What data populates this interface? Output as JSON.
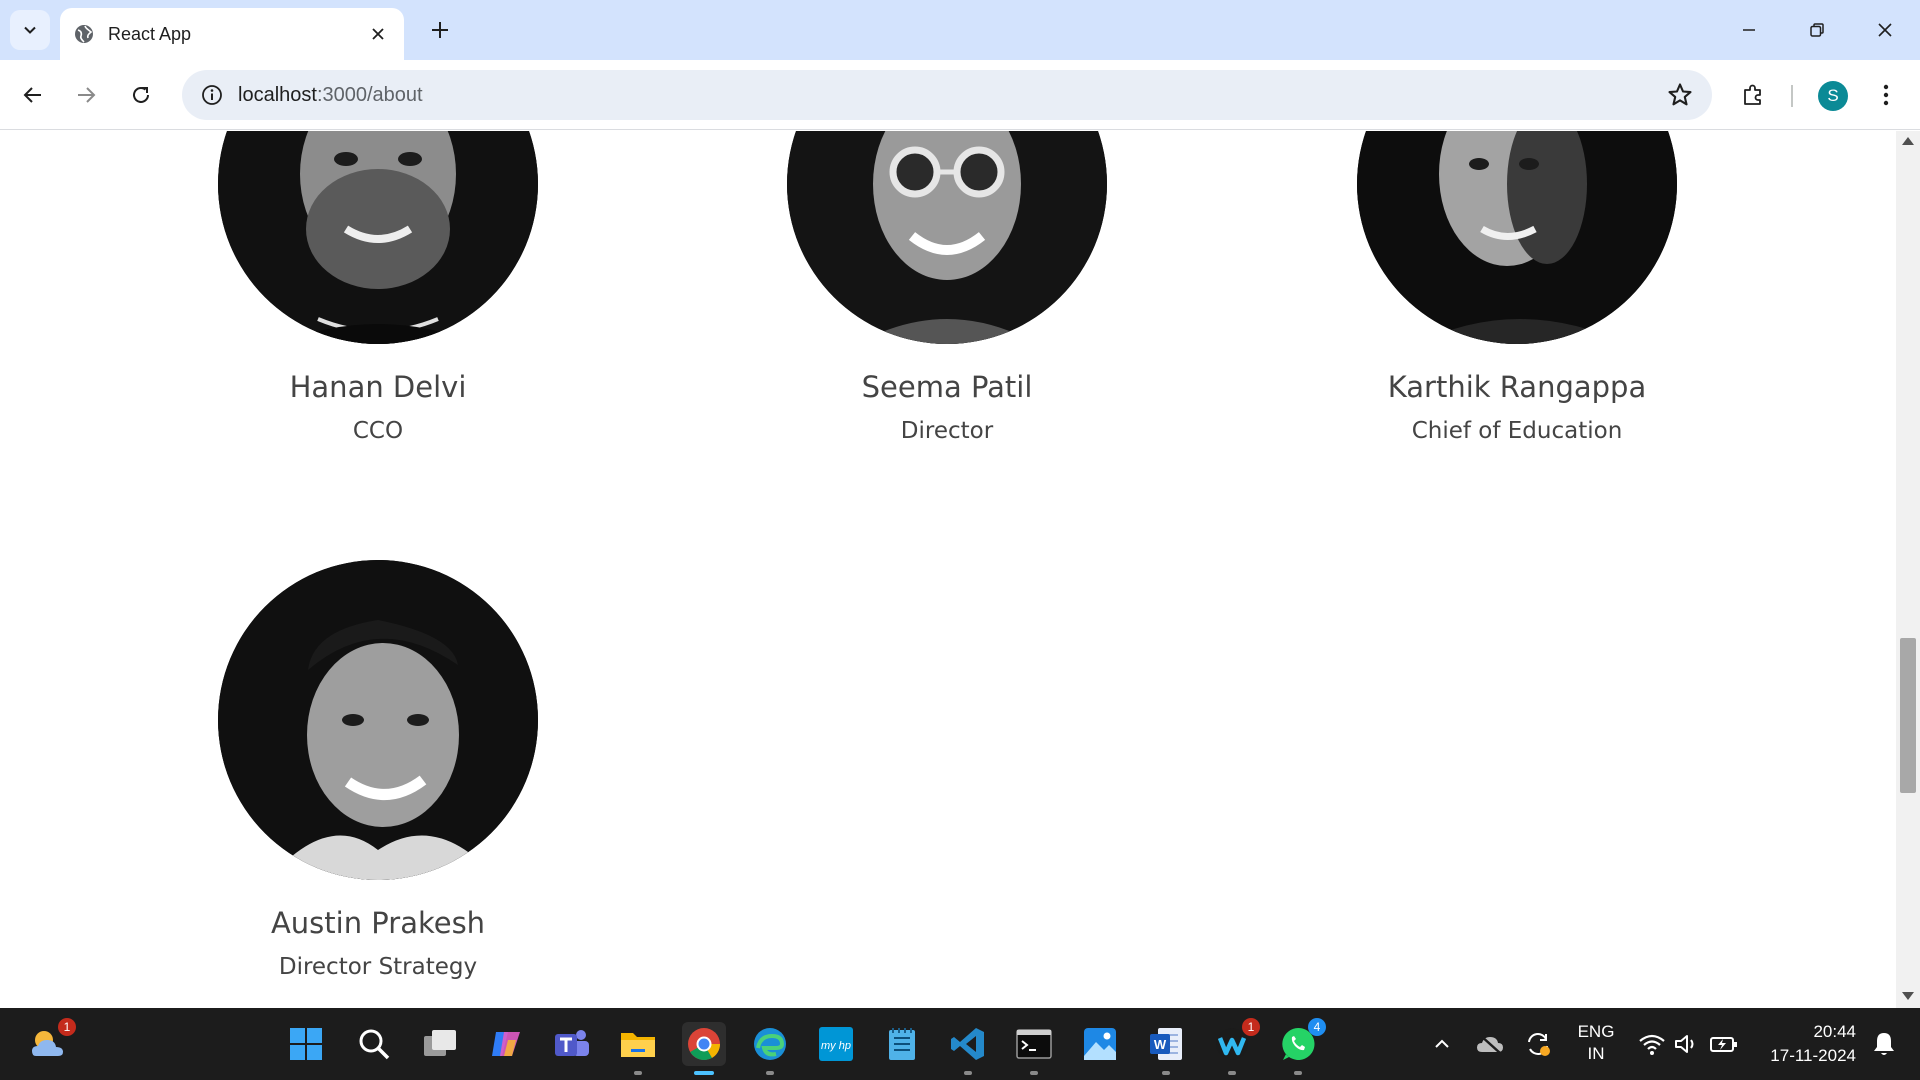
{
  "browser": {
    "tab_title": "React App",
    "url_host": "localhost",
    "url_path": ":3000/about",
    "profile_initial": "S"
  },
  "team": [
    {
      "name": "Hanan Delvi",
      "role": "CCO"
    },
    {
      "name": "Seema Patil",
      "role": "Director"
    },
    {
      "name": "Karthik Rangappa",
      "role": "Chief of Education"
    },
    {
      "name": "Austin Prakesh",
      "role": "Director Strategy"
    }
  ],
  "taskbar": {
    "weather_badge": "1",
    "webex_badge": "1",
    "whatsapp_badge": "4",
    "language_line1": "ENG",
    "language_line2": "IN",
    "time": "20:44",
    "date": "17-11-2024"
  },
  "colors": {
    "tabbar_bg": "#d3e3fd",
    "omnibox_bg": "#e9eef6",
    "avatar_bg": "#0b8a96",
    "text": "#444444",
    "taskbar_bg": "#1c1c1c"
  }
}
